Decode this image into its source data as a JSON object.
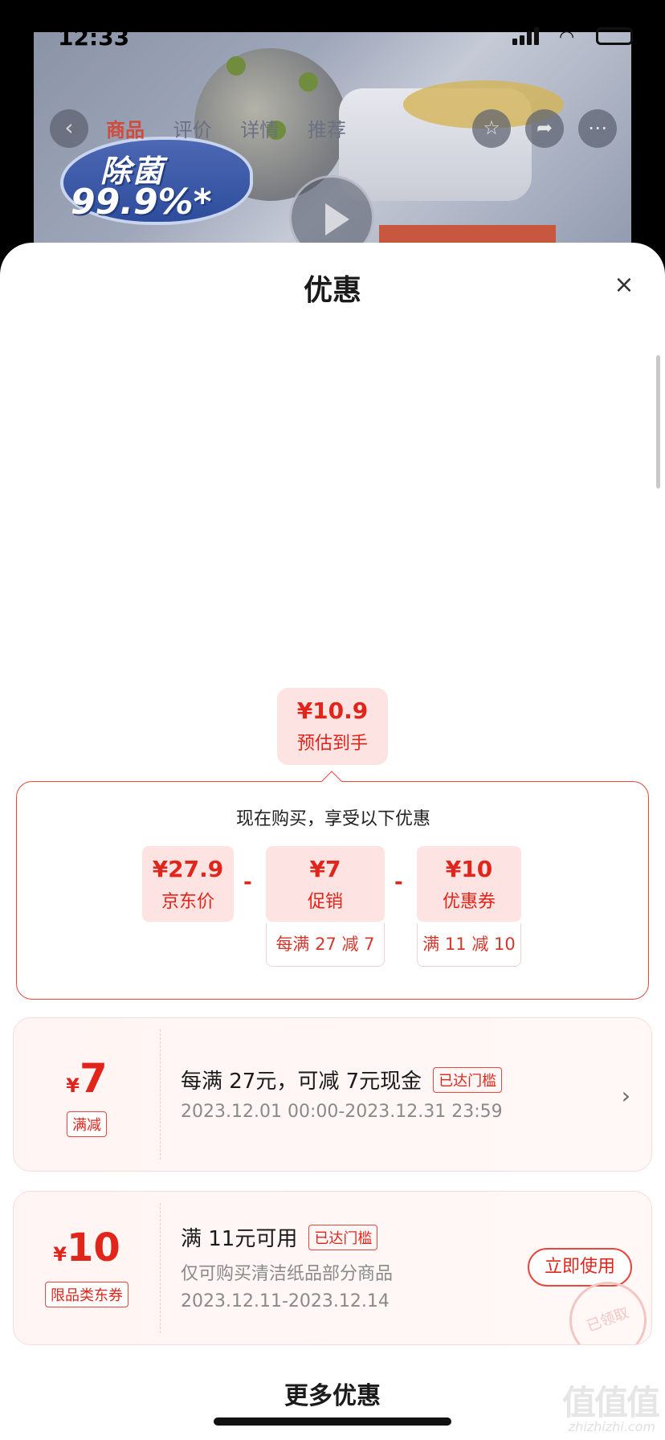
{
  "status_bar": {
    "time": "12:33"
  },
  "product_nav": {
    "tabs": [
      "商品",
      "评价",
      "详情",
      "推荐"
    ],
    "active_tab": "商品",
    "promo_line1": "除菌",
    "promo_line2": "99.9%*"
  },
  "sheet": {
    "title": "优惠",
    "close_icon": "×"
  },
  "estimate": {
    "price": "¥10.9",
    "label": "预估到手"
  },
  "calc": {
    "heading": "现在购买，享受以下优惠",
    "items": [
      {
        "value": "¥27.9",
        "label": "京东价",
        "sub": ""
      },
      {
        "value": "¥7",
        "label": "促销",
        "sub": "每满 27 减 7"
      },
      {
        "value": "¥10",
        "label": "优惠券",
        "sub": "满 11 减 10"
      }
    ],
    "operator": "-"
  },
  "coupons": [
    {
      "currency": "¥",
      "amount": "7",
      "type": "满减",
      "title": "每满 27元，可减 7元现金",
      "badge": "已达门槛",
      "lines": [
        "2023.12.01 00:00-2023.12.31 23:59"
      ],
      "action": "›"
    },
    {
      "currency": "¥",
      "amount": "10",
      "type": "限品类东券",
      "title": "满 11元可用",
      "badge": "已达门槛",
      "lines": [
        "仅可购买清洁纸品部分商品",
        "2023.12.11-2023.12.14"
      ],
      "action": "立即使用",
      "stamp": "已领取"
    }
  ],
  "more": {
    "title": "更多优惠"
  },
  "watermark": {
    "text": "值值值",
    "sub": "zhizhizhi.com"
  },
  "colors": {
    "accent": "#e1251b",
    "accent_bg": "#fde3e1"
  }
}
